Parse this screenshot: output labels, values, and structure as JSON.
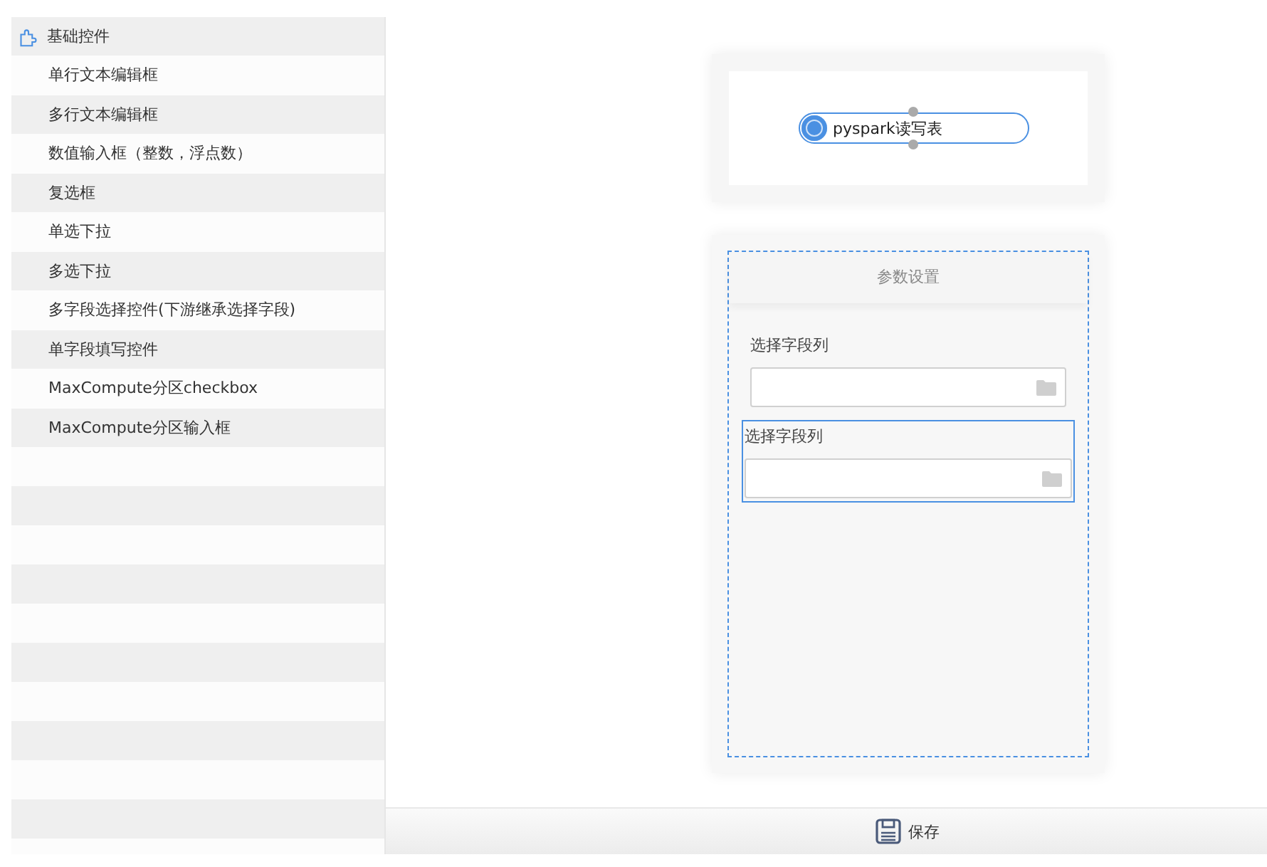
{
  "sidebar": {
    "group": {
      "label": "基础控件",
      "items": [
        {
          "label": "单行文本编辑框"
        },
        {
          "label": "多行文本编辑框"
        },
        {
          "label": "数值输入框（整数，浮点数）"
        },
        {
          "label": "复选框"
        },
        {
          "label": "单选下拉"
        },
        {
          "label": "多选下拉"
        },
        {
          "label": "多字段选择控件(下游继承选择字段)"
        },
        {
          "label": "单字段填写控件"
        },
        {
          "label": "MaxCompute分区checkbox"
        },
        {
          "label": "MaxCompute分区输入框"
        }
      ]
    }
  },
  "node": {
    "label": "pyspark读写表"
  },
  "params": {
    "title": "参数设置",
    "fields": [
      {
        "label": "选择字段列",
        "selected": false
      },
      {
        "label": "选择字段列",
        "selected": true
      }
    ]
  },
  "footer": {
    "save": "保存"
  }
}
